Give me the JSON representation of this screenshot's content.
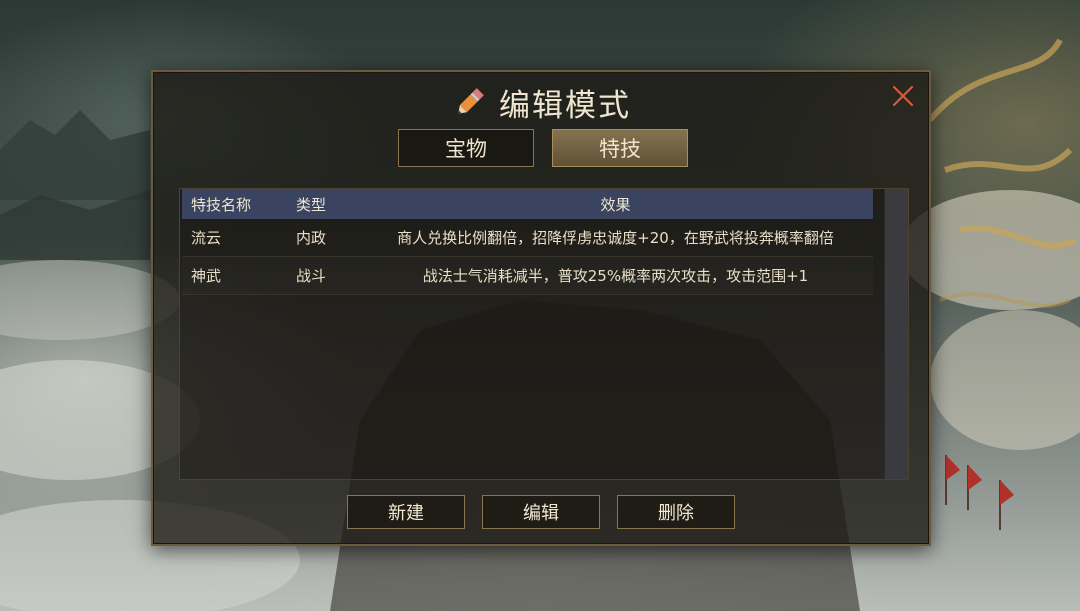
{
  "dialog": {
    "title": "编辑模式",
    "title_icon": "pencil-icon",
    "close_icon": "close-icon"
  },
  "tabs": [
    {
      "label": "宝物",
      "active": false
    },
    {
      "label": "特技",
      "active": true
    }
  ],
  "table": {
    "headers": {
      "name": "特技名称",
      "type": "类型",
      "effect": "效果"
    },
    "rows": [
      {
        "name": "流云",
        "type": "内政",
        "effect": "商人兑换比例翻倍，招降俘虏忠诚度+20，在野武将投奔概率翻倍"
      },
      {
        "name": "神武",
        "type": "战斗",
        "effect": "战法士气消耗减半，普攻25%概率两次攻击，攻击范围+1"
      }
    ]
  },
  "actions": {
    "new_label": "新建",
    "edit_label": "编辑",
    "delete_label": "删除"
  },
  "colors": {
    "header_bg": "#3a4460",
    "border_gold": "#8a7550",
    "close_red": "#d85a3a",
    "pencil_orange": "#e8913a"
  }
}
